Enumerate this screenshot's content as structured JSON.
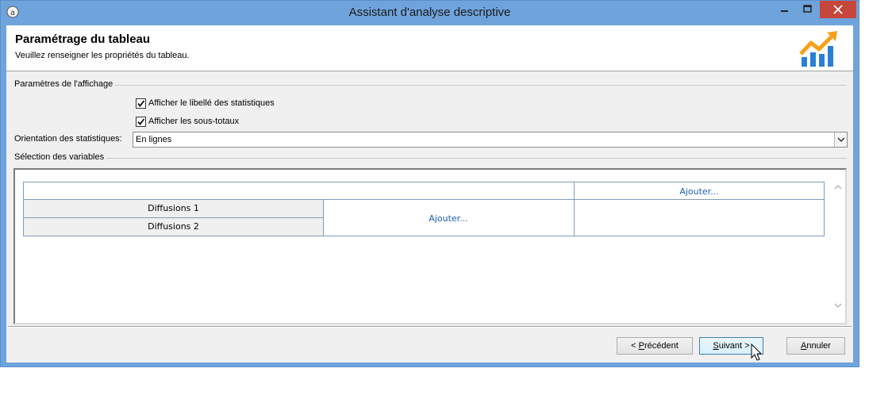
{
  "window": {
    "title": "Assistant d'analyse descriptive",
    "controls": {
      "minimize": "minimize-icon",
      "maximize": "maximize-icon",
      "close": "close-icon"
    }
  },
  "header": {
    "title": "Paramétrage du tableau",
    "subtitle": "Veuillez renseigner les propriétés du tableau."
  },
  "display_settings": {
    "group_label": "Paramètres de l'affichage",
    "show_stat_labels": {
      "label": "Afficher le libellé des statistiques",
      "checked": true
    },
    "show_subtotals": {
      "label": "Afficher les sous-totaux",
      "checked": true
    },
    "orientation_label": "Orientation des statistiques:",
    "orientation_value": "En lignes"
  },
  "variables": {
    "group_label": "Sélection des variables",
    "add_column_link": "Ajouter...",
    "add_cell_link": "Ajouter...",
    "rows": [
      "Diffusions 1",
      "Diffusions 2"
    ]
  },
  "footer": {
    "prev_prefix": "< ",
    "prev_mnemonic": "P",
    "prev_rest": "récédent",
    "next_mnemonic": "S",
    "next_rest": "uivant >",
    "cancel_mnemonic": "A",
    "cancel_rest": "nnuler"
  },
  "colors": {
    "titlebar": "#6fa3dc",
    "close": "#c7463b",
    "link": "#1d5fb4",
    "logo_orange": "#f5a11a",
    "logo_blue": "#2a7fd4"
  }
}
